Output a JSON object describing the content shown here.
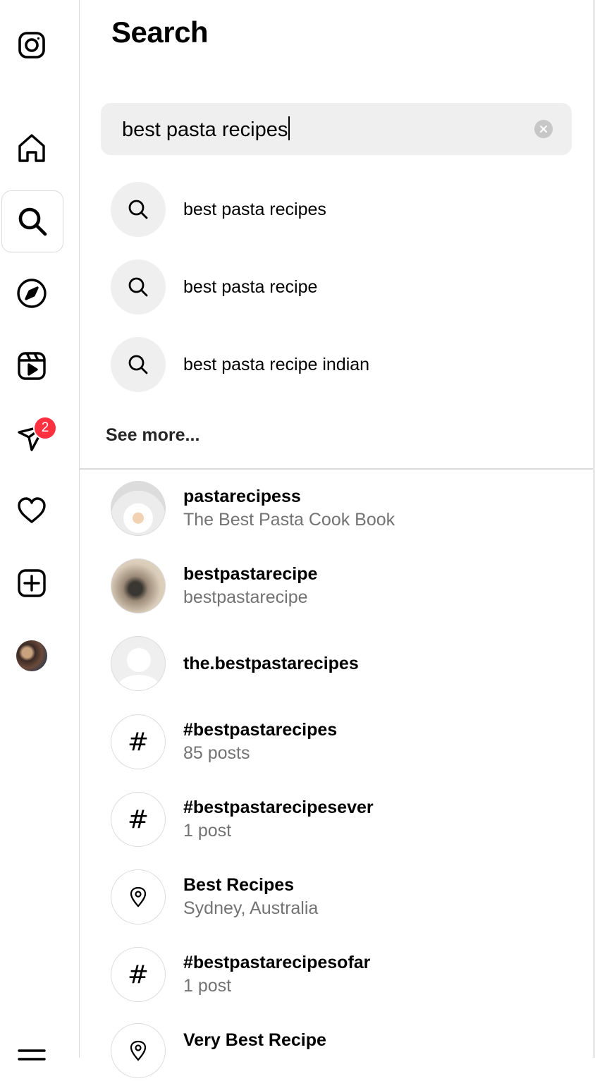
{
  "rail": {
    "items": [
      {
        "name": "instagram-logo-icon"
      },
      {
        "name": "home-icon"
      },
      {
        "name": "search-icon"
      },
      {
        "name": "explore-icon"
      },
      {
        "name": "reels-icon"
      },
      {
        "name": "messages-icon"
      },
      {
        "name": "notifications-icon"
      },
      {
        "name": "create-icon"
      },
      {
        "name": "profile-avatar"
      },
      {
        "name": "more-menu-icon"
      }
    ],
    "messages_badge": "2"
  },
  "search": {
    "title": "Search",
    "query": "best pasta recipes",
    "suggestions": [
      {
        "text": "best pasta recipes"
      },
      {
        "text": "best pasta recipe"
      },
      {
        "text": "best pasta recipe indian"
      }
    ],
    "see_more": "See more...",
    "results": [
      {
        "kind": "account",
        "primary": "pastarecipess",
        "secondary": "The Best Pasta Cook Book"
      },
      {
        "kind": "account",
        "primary": "bestpastarecipe",
        "secondary": "bestpastarecipe"
      },
      {
        "kind": "account",
        "primary": "the.bestpastarecipes",
        "secondary": ""
      },
      {
        "kind": "hashtag",
        "primary": "#bestpastarecipes",
        "secondary": "85 posts",
        "symbol": "#"
      },
      {
        "kind": "hashtag",
        "primary": "#bestpastarecipesever",
        "secondary": "1 post",
        "symbol": "#"
      },
      {
        "kind": "place",
        "primary": "Best Recipes",
        "secondary": "Sydney, Australia"
      },
      {
        "kind": "hashtag",
        "primary": "#bestpastarecipesofar",
        "secondary": "1 post",
        "symbol": "#"
      },
      {
        "kind": "place",
        "primary": "Very Best Recipe",
        "secondary": ""
      }
    ]
  }
}
